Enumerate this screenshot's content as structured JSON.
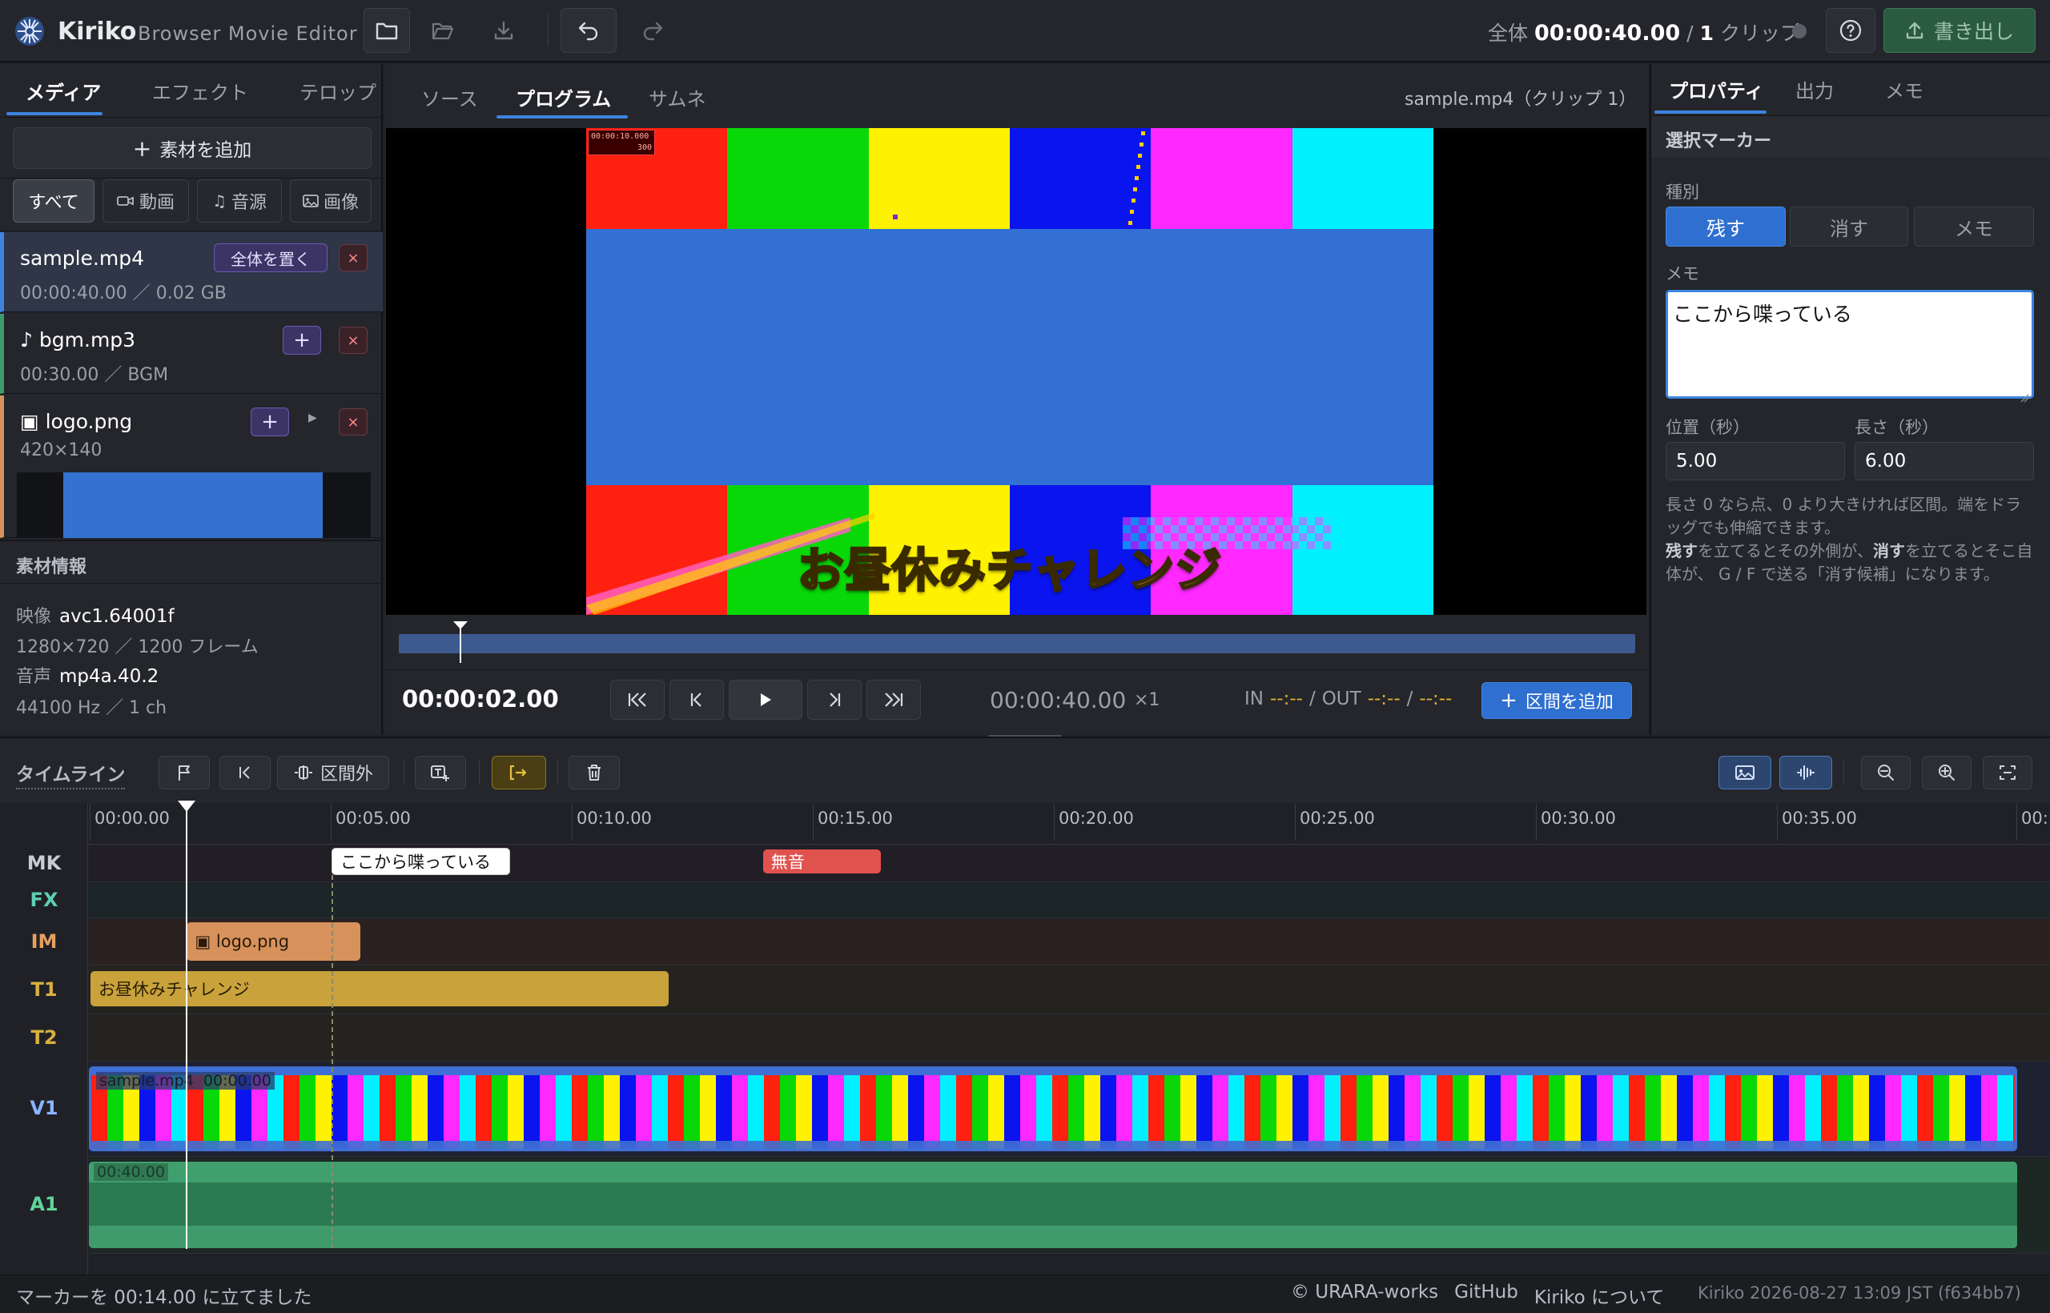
{
  "header": {
    "title": "Kiriko",
    "subtitle": "Browser Movie Editor",
    "total_label": "全体",
    "total_time": "00:00:40.00",
    "clip_sep": "/",
    "clip_count": "1",
    "clip_label": "クリップ",
    "export_label": "書き出し"
  },
  "left": {
    "tabs": [
      "メディア",
      "エフェクト",
      "テロップ"
    ],
    "add_label": "素材を追加",
    "filters": [
      "すべて",
      "動画",
      "音源",
      "画像"
    ],
    "items": [
      {
        "name": "sample.mp4",
        "meta": "00:00:40.00 ／ 0.02 GB",
        "action": "全体を置く"
      },
      {
        "name": "bgm.mp3",
        "meta": "00:30.00 ／ BGM",
        "action": "+"
      },
      {
        "name": "logo.png",
        "meta": "420×140",
        "action": "+"
      }
    ],
    "close_glyph": "×",
    "info_title": "素材情報",
    "info": {
      "video_key": "映像",
      "video_val": "avc1.64001f",
      "res": "1280×720 ／ 1200 フレーム",
      "audio_key": "音声",
      "audio_val": "mp4a.40.2",
      "audio_meta": "44100 Hz ／ 1 ch"
    }
  },
  "center": {
    "tabs": [
      "ソース",
      "プログラム",
      "サムネ"
    ],
    "source_info": "sample.mp4（クリップ 1）",
    "preview": {
      "timecode": "00:00:10.000",
      "frame": "300",
      "caption": "お昼休みチャレンジ"
    },
    "playhead_pct": 5,
    "current_time": "00:00:02.00",
    "duration": "00:00:40.00",
    "speed": "×1",
    "in_label": "IN",
    "in_val": "--:--",
    "out_label": "OUT",
    "out_val": "--:--",
    "range_val": "--:--",
    "slash": "/",
    "add_range_label": "区間を追加"
  },
  "right": {
    "tabs": [
      "プロパティ",
      "出力",
      "メモ"
    ],
    "section_title": "選択マーカー",
    "kind_label": "種別",
    "kinds": [
      "残す",
      "消す",
      "メモ"
    ],
    "memo_label": "メモ",
    "memo_value": "ここから喋っている",
    "pos_label": "位置（秒）",
    "pos_value": "5.00",
    "len_label": "長さ（秒）",
    "len_value": "6.00",
    "help1": "長さ 0 なら点、0 より大きければ区間。端をドラッグでも伸縮できます。",
    "help2_bold1": "残す",
    "help2_a": "を立てるとその外側が、",
    "help2_bold2": "消す",
    "help2_b": "を立てるとそこ自体が、 G / F で送る「消す候補」になります。"
  },
  "timeline": {
    "title": "タイムライン",
    "out_of_range_label": "区間外",
    "ticks": [
      "00:00.00",
      "00:05.00",
      "00:10.00",
      "00:15.00",
      "00:20.00",
      "00:25.00",
      "00:30.00",
      "00:35.00",
      "00:"
    ],
    "tracks": [
      "MK",
      "FX",
      "IM",
      "T1",
      "T2",
      "V1",
      "A1"
    ],
    "markers": [
      {
        "label": "ここから喋っている",
        "start": 5.0,
        "length": 6.0
      },
      {
        "label": "無音",
        "start": 14.0,
        "length": 4.0
      }
    ],
    "im_clip": {
      "label": "logo.png",
      "start": 2.0,
      "length": 4.0
    },
    "t1_clip": {
      "label": "お昼休みチャレンジ",
      "start": 0.0,
      "length": 12.0
    },
    "v1_clip": {
      "label": "sample.mp4",
      "time": "00:00.00"
    },
    "a1_clip": {
      "label": "00:40.00"
    },
    "playhead_sec": 2.0
  },
  "footer": {
    "status": "マーカーを 00:14.00 に立てました",
    "credit": "© URARA-works",
    "github": "GitHub",
    "about": "Kiriko について",
    "version": "Kiriko 2026-08-27 13:09 JST (f634bb7)"
  },
  "colors": {
    "accent": "#3d84e0",
    "marker_keep": "#ffffff",
    "marker_cut": "#e0524e",
    "image_clip": "#d6925a",
    "text_clip": "#c9a23c",
    "audio_clip": "#3f9a6c",
    "video_border": "#3f6fd4"
  }
}
